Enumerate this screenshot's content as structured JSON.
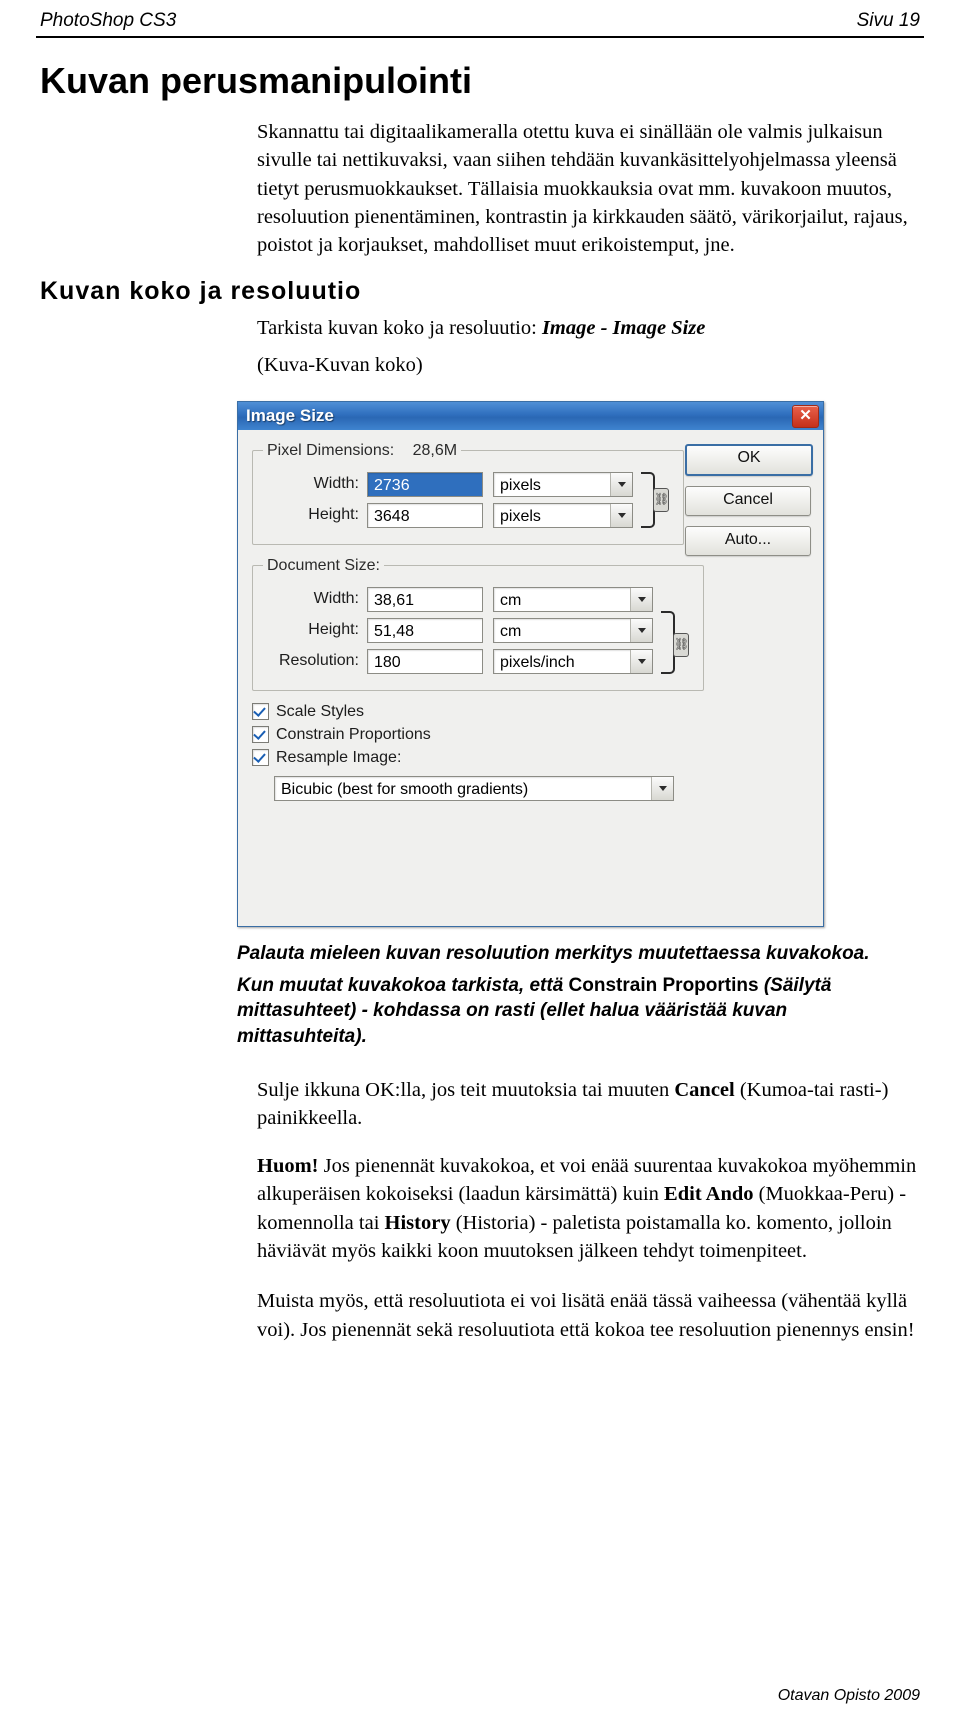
{
  "header": {
    "left": "PhotoShop CS3",
    "right": "Sivu 19"
  },
  "title": "Kuvan perusmanipulointi",
  "intro": "Skannattu tai digitaalikameralla otettu kuva ei sinällään ole valmis julkaisun sivulle tai nettikuvaksi, vaan siihen tehdään kuvankäsittelyohjelmassa yleensä tietyt perusmuokkaukset. Tällaisia muokkauksia ovat mm. kuvakoon muutos, resoluution pienentäminen, kontrastin ja kirkkauden säätö, värikorjailut, rajaus, poistot ja korjaukset, mahdolliset muut erikoistemput, jne.",
  "section_title": "Kuvan koko ja resoluutio",
  "check_line_1": "Tarkista kuvan koko ja resoluutio: ",
  "check_line_1_bold": "Image - Image Size",
  "check_line_2": "(Kuva-Kuvan koko)",
  "dialog": {
    "title": "Image Size",
    "close_label": "✕",
    "pixel_group": {
      "legend": "Pixel Dimensions:",
      "size": "28,6M",
      "width_label": "Width:",
      "width_value": "2736",
      "width_unit": "pixels",
      "height_label": "Height:",
      "height_value": "3648",
      "height_unit": "pixels"
    },
    "document_group": {
      "legend": "Document Size:",
      "width_label": "Width:",
      "width_value": "38,61",
      "width_unit": "cm",
      "height_label": "Height:",
      "height_value": "51,48",
      "height_unit": "cm",
      "resolution_label": "Resolution:",
      "resolution_value": "180",
      "resolution_unit": "pixels/inch"
    },
    "checkboxes": [
      {
        "label": "Scale Styles",
        "checked": true
      },
      {
        "label": "Constrain Proportions",
        "checked": true
      },
      {
        "label": "Resample Image:",
        "checked": true
      }
    ],
    "resample_method": "Bicubic (best for smooth gradients)",
    "buttons": [
      {
        "label": "OK"
      },
      {
        "label": "Cancel"
      },
      {
        "label": "Auto..."
      }
    ]
  },
  "note_bold_1": "Palauta mieleen kuvan resoluution merkitys muutettaessa kuvakokoa.",
  "note_bold_2_a": "Kun muutat kuvakokoa tarkista, että ",
  "note_bold_2_b": "Constrain Proportins",
  "note_bold_2_c": " (Säilytä mittasuhteet) - kohdassa on rasti (ellet halua vääristää kuvan mittasuhteita).",
  "para_close_a": "Sulje ikkuna OK:lla, jos teit muutoksia tai muuten ",
  "para_close_b": "Cancel",
  "para_close_c": " (Kumoa-tai rasti-) painikkeella.",
  "para_note_a": "Huom!",
  "para_note_b": " Jos pienennät kuvakokoa, et voi enää suurentaa kuvakokoa myöhemmin alkuperäisen kokoiseksi (laadun kärsimättä) kuin ",
  "para_note_c": "Edit Ando",
  "para_note_d": " (Muokkaa-Peru) - komennolla tai ",
  "para_note_e": "History",
  "para_note_f": " (Historia) - paletista poistamalla ko. komento, jolloin häviävät myös kaikki koon muutoksen jälkeen tehdyt toimenpiteet.",
  "para_last": "Muista myös, että resoluutiota ei voi lisätä enää tässä vaiheessa (vähentää kyllä voi). Jos pienennät sekä resoluutiota että kokoa tee resoluution pienennys ensin!",
  "footer": "Otavan Opisto 2009"
}
